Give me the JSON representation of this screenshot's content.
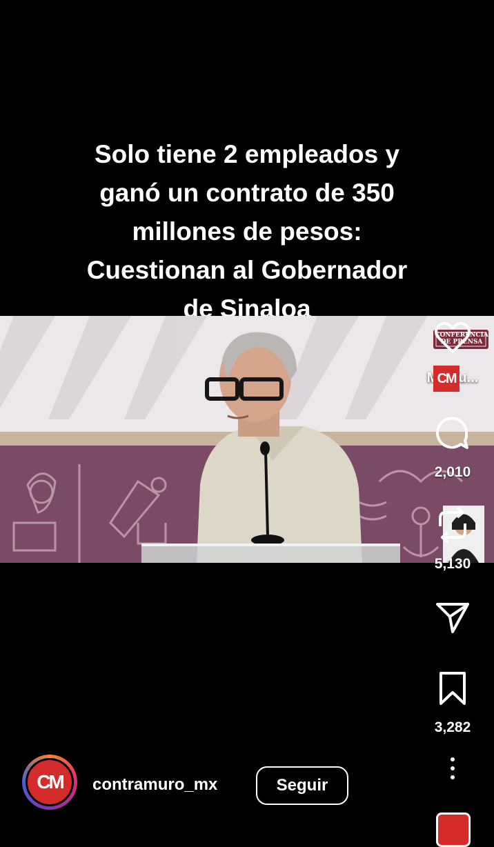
{
  "video": {
    "caption_lines": [
      "Solo tiene 2 empleados y",
      "ganó un contrato de 350",
      "millones de pesos:",
      "Cuestionan al Gobernador",
      "de Sinaloa"
    ],
    "overlay_badge": "CONFERENCIA DE PRENSA"
  },
  "actions": {
    "like_label": "Me gu...",
    "comment_count": "2,010",
    "repost_count": "5,130",
    "save_count": "3,282",
    "icons": [
      "heart-icon",
      "comment-icon",
      "repost-icon",
      "share-icon",
      "bookmark-icon",
      "more-icon"
    ]
  },
  "author": {
    "username": "contramuro_mx",
    "avatar_text": "CM",
    "follow_label": "Seguir"
  },
  "colors": {
    "background": "#000000",
    "brand_red": "#d42b2b",
    "backdrop_purple": "#7a4a66"
  }
}
